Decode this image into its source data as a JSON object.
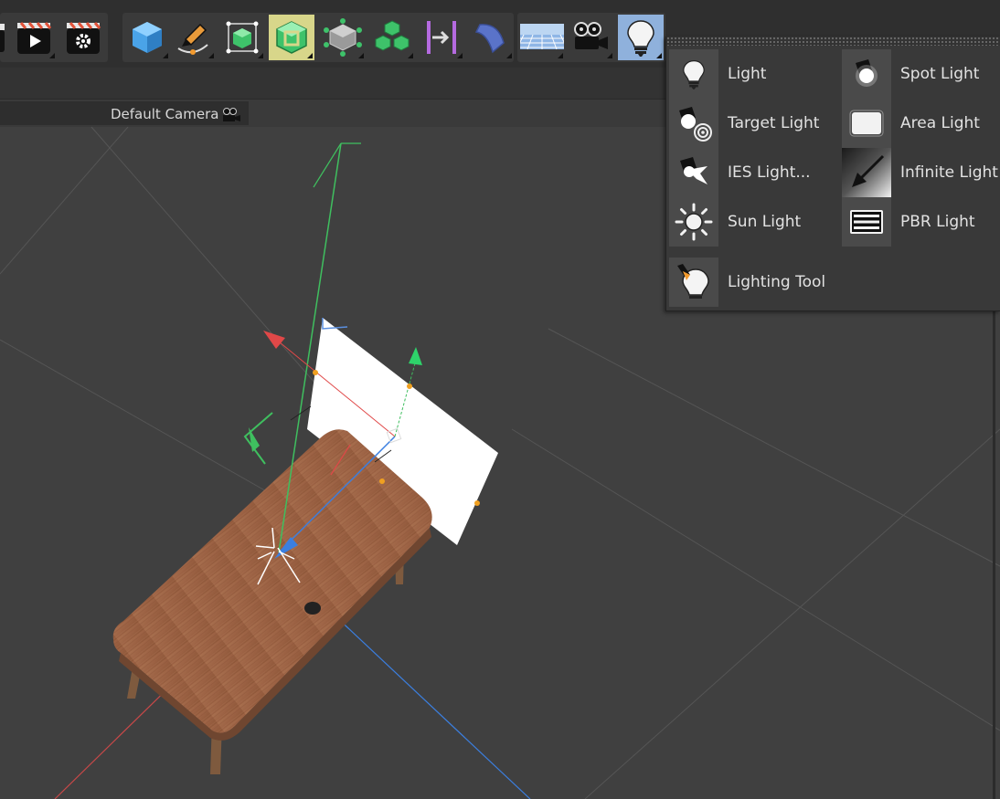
{
  "viewport": {
    "camera_label": "Default Camera"
  },
  "toolbar": {
    "buttons": [
      {
        "name": "clapper-icon",
        "active": false
      },
      {
        "name": "render-play-icon",
        "active": false
      },
      {
        "name": "render-settings-icon",
        "active": false
      },
      {
        "name": "cube-icon",
        "active": false
      },
      {
        "name": "pen-icon",
        "active": false
      },
      {
        "name": "subdivision-cube-icon",
        "active": false
      },
      {
        "name": "generator-cube-icon",
        "active": true
      },
      {
        "name": "volume-cube-icon",
        "active": false
      },
      {
        "name": "cloner-cubes-icon",
        "active": false
      },
      {
        "name": "deformer-bend-icon",
        "active": false
      },
      {
        "name": "spline-deform-icon",
        "active": false
      },
      {
        "name": "floor-icon",
        "active": false
      },
      {
        "name": "camera-icon",
        "active": false
      },
      {
        "name": "light-icon",
        "active": true
      }
    ]
  },
  "light_menu": {
    "items": [
      {
        "label": "Light",
        "icon": "bulb-icon"
      },
      {
        "label": "Spot Light",
        "icon": "spot-light-icon"
      },
      {
        "label": "Target Light",
        "icon": "target-light-icon"
      },
      {
        "label": "Area Light",
        "icon": "area-light-icon"
      },
      {
        "label": "IES Light...",
        "icon": "ies-light-icon"
      },
      {
        "label": "Infinite Light",
        "icon": "infinite-light-icon"
      },
      {
        "label": "Sun Light",
        "icon": "sun-light-icon"
      },
      {
        "label": "PBR Light",
        "icon": "pbr-light-icon"
      },
      {
        "label": "Lighting Tool",
        "icon": "lighting-tool-icon"
      }
    ]
  },
  "colors": {
    "viewport_bg": "#404040",
    "axis_x": "#e04848",
    "axis_y": "#3fbf5f",
    "axis_z": "#3b7fe0",
    "table_wood": "#a0684a",
    "highlight_yellow": "#d8d68a",
    "highlight_blue": "#8fb1dc"
  }
}
